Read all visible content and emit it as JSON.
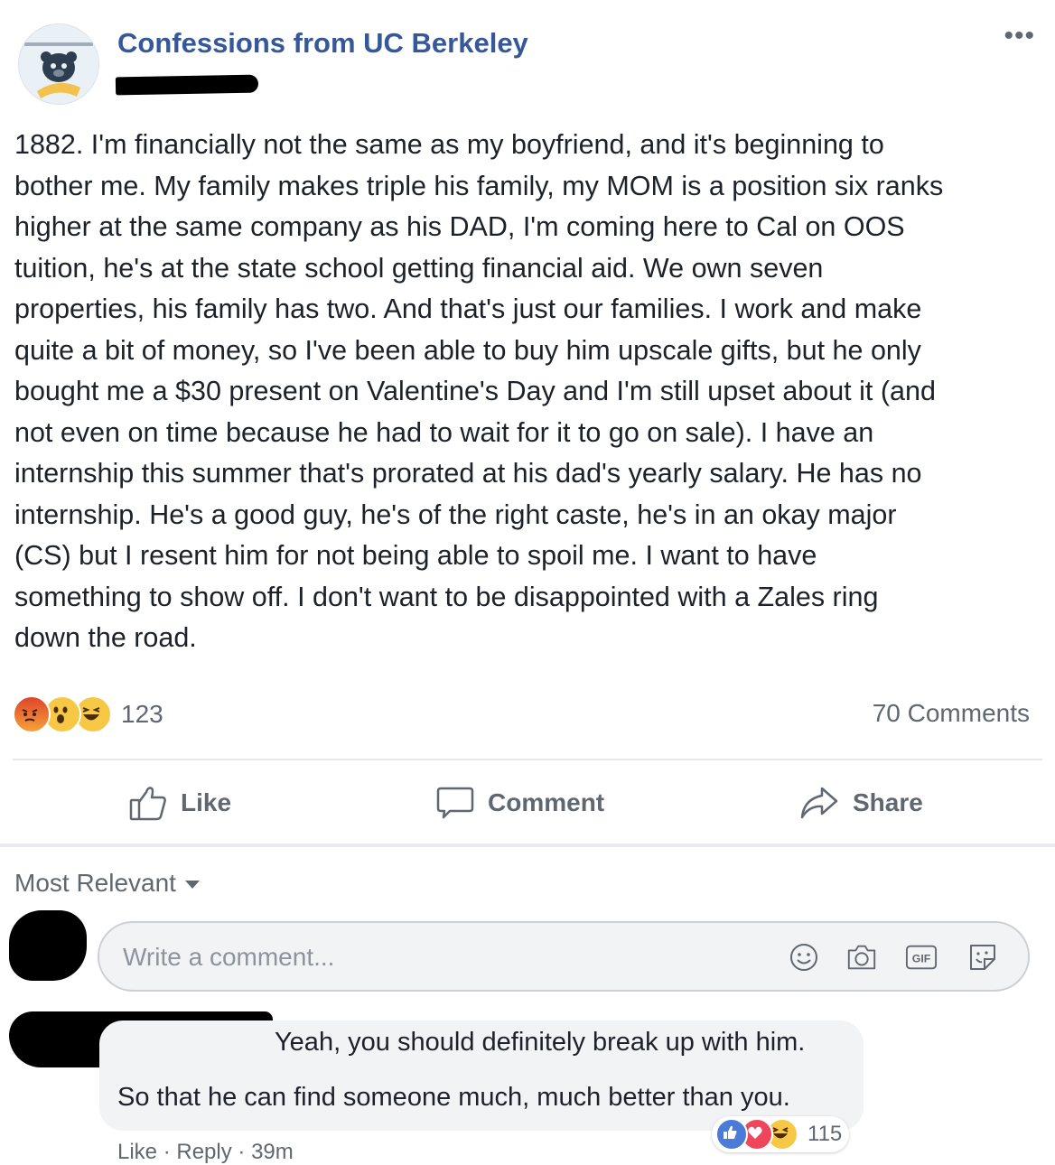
{
  "post": {
    "page_name": "Confessions from UC Berkeley",
    "avatar_icon": "bear-logo-icon",
    "more_icon": "more-options-icon",
    "text": "1882. I'm financially not the same as my boyfriend, and it's beginning to\nbother me. My family makes triple his family, my MOM is a position six ranks\nhigher at the same company as his DAD, I'm coming here to Cal on OOS\ntuition, he's at the state school getting financial aid. We own seven\nproperties, his family has two. And that's just our families. I work and make\nquite a bit of money, so I've been able to buy him upscale gifts, but he only\nbought me a $30 present on Valentine's Day and I'm still upset about it (and\nnot even on time because he had to wait for it to go on sale). I have an\ninternship this summer that's prorated at his dad's yearly salary. He has no\ninternship. He's a good guy, he's of the right caste, he's in an okay major\n(CS) but I resent him for not being able to spoil me. I want to have\nsomething to show off. I don't want to be disappointed with a Zales ring\ndown the road.",
    "reaction_count": "123",
    "reaction_icons": [
      "angry-icon",
      "wow-icon",
      "haha-icon"
    ],
    "comment_count": "70 Comments"
  },
  "actions": {
    "like_label": "Like",
    "comment_label": "Comment",
    "share_label": "Share"
  },
  "comments": {
    "sort_label": "Most Relevant",
    "composer_placeholder": "Write a comment...",
    "composer_icons": [
      "emoji-icon",
      "camera-icon",
      "gif-icon",
      "sticker-icon"
    ],
    "gif_label": "GIF",
    "reply": {
      "line1": "Yeah, you should definitely break up with him.",
      "line2": "So that he can find someone much, much better than you.",
      "like_link": "Like",
      "reply_link": "Reply",
      "time": "39m",
      "reaction_count": "115",
      "reaction_icons": [
        "like-icon",
        "love-icon",
        "haha-icon"
      ]
    }
  },
  "colors": {
    "page_name": "#365899",
    "text": "#1d2129",
    "secondary": "#606770"
  }
}
